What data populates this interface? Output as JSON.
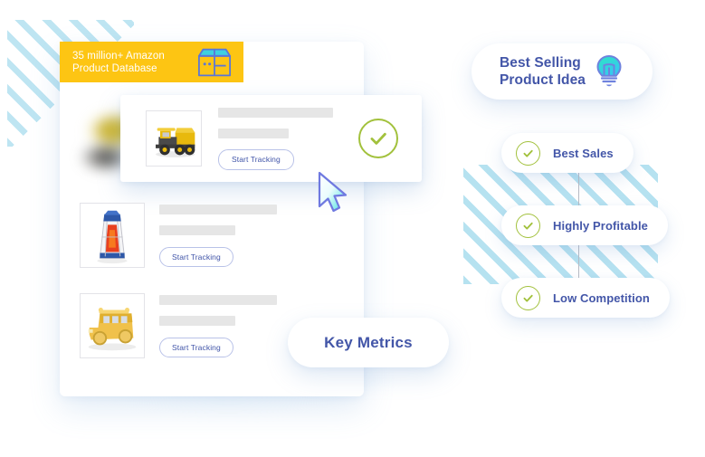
{
  "colors": {
    "badge_yellow": "#fdc513",
    "accent_navy": "#4356a8",
    "check_green": "#a2c13c",
    "stripe_blue": "#a9ddee",
    "panel_white": "#ffffff",
    "placeholder_grey": "#e6e6e6",
    "button_border": "#b9c2e8"
  },
  "badge": {
    "text": "35 million+ Amazon\nProduct Database",
    "icon": "open-box-icon"
  },
  "left_panel": {
    "products": [
      {
        "thumbnail": "yellow-dump-truck-toy",
        "title_placeholder": "",
        "subtitle_placeholder": "",
        "button_label": "Start Tracking",
        "selected": true,
        "status_icon": "green-check-circle-icon"
      },
      {
        "thumbnail": "stained-glass-lamp",
        "title_placeholder": "",
        "subtitle_placeholder": "",
        "button_label": "Start Tracking",
        "selected": false
      },
      {
        "thumbnail": "yellow-school-bus-toy",
        "title_placeholder": "",
        "subtitle_placeholder": "",
        "button_label": "Start Tracking",
        "selected": false
      }
    ],
    "cursor_icon": "mouse-pointer-icon"
  },
  "key_metrics": {
    "label": "Key Metrics"
  },
  "right_panel": {
    "header": {
      "label": "Best Selling\nProduct Idea",
      "icon": "lightbulb-icon"
    },
    "features": [
      {
        "label": "Best Sales",
        "icon": "green-check-circle-icon"
      },
      {
        "label": "Highly Profitable",
        "icon": "green-check-circle-icon"
      },
      {
        "label": "Low Competition",
        "icon": "green-check-circle-icon"
      }
    ]
  },
  "decorations": {
    "stripes_top_left": "diagonal-stripes",
    "stripes_right": "diagonal-stripes",
    "connector": "vertical-connector-line"
  }
}
